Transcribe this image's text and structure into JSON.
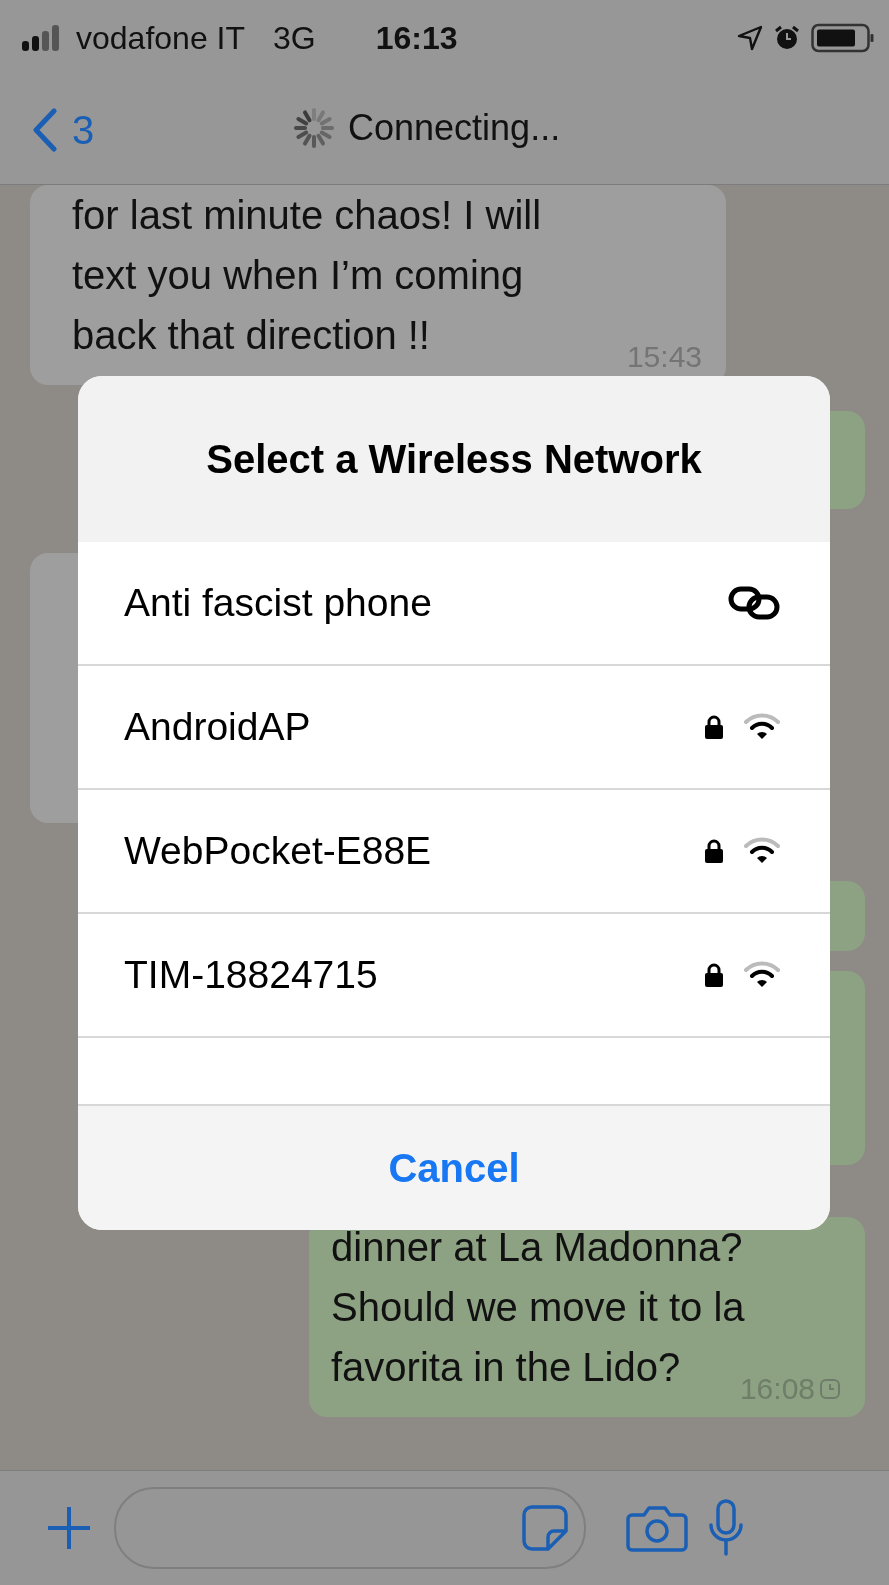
{
  "status_bar": {
    "carrier": "vodafone IT",
    "network": "3G",
    "time": "16:13"
  },
  "nav": {
    "back_count": "3",
    "title": "Connecting..."
  },
  "messages": [
    {
      "kind": "incoming",
      "lines": [
        "for last minute chaos! I will",
        "text you when I’m coming",
        "back that direction !!"
      ],
      "time": "15:43"
    },
    {
      "kind": "hidden-outgoing"
    },
    {
      "kind": "hidden-incoming"
    },
    {
      "kind": "hidden-outgoing"
    },
    {
      "kind": "hidden-outgoing"
    },
    {
      "kind": "outgoing",
      "lines": [
        "dinner at La Madonna?",
        "Should we move it to la",
        "favorita in the Lido?"
      ],
      "time": "16:08"
    }
  ],
  "dialog": {
    "title": "Select a Wireless Network",
    "networks": [
      {
        "name": "Anti fascist phone",
        "kind": "linked"
      },
      {
        "name": "AndroidAP",
        "kind": "secured"
      },
      {
        "name": "WebPocket-E88E",
        "kind": "secured"
      },
      {
        "name": "TIM-18824715",
        "kind": "secured"
      }
    ],
    "cancel": "Cancel"
  }
}
